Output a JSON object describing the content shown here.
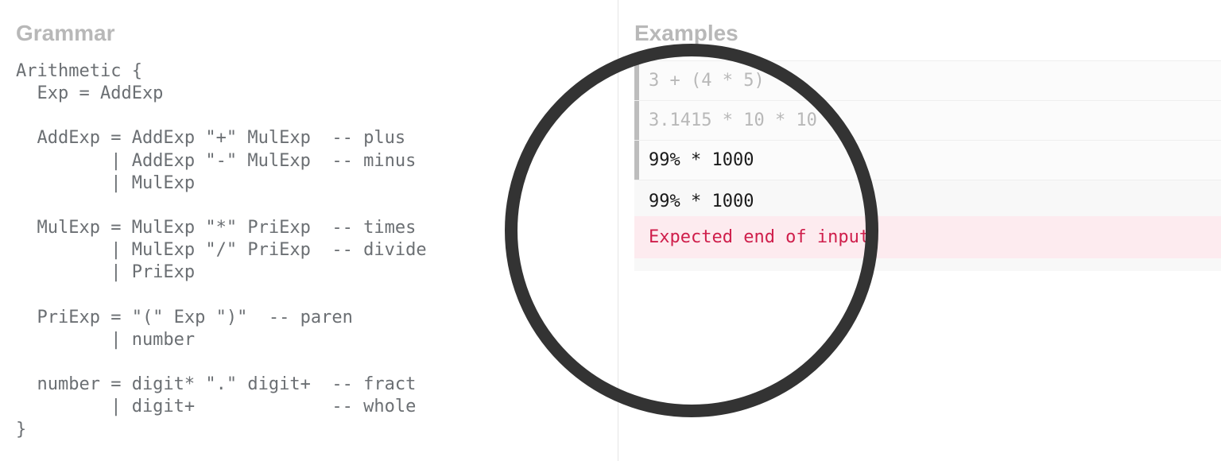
{
  "left": {
    "title": "Grammar",
    "code": "Arithmetic {\n  Exp = AddExp\n\n  AddExp = AddExp \"+\" MulExp  -- plus\n         | AddExp \"-\" MulExp  -- minus\n         | MulExp\n\n  MulExp = MulExp \"*\" PriExp  -- times\n         | MulExp \"/\" PriExp  -- divide\n         | PriExp\n\n  PriExp = \"(\" Exp \")\"  -- paren\n         | number\n\n  number = digit* \".\" digit+  -- fract\n         | digit+             -- whole\n}"
  },
  "right": {
    "title": "Examples",
    "rows": [
      {
        "text": "3 + (4 * 5)",
        "status": "pass"
      },
      {
        "text": "3.1415 * 10 * 10",
        "status": "pass"
      },
      {
        "text": "99% * 1000",
        "status": "fail"
      }
    ],
    "output": "99% * 1000",
    "error": "Expected end of input"
  }
}
